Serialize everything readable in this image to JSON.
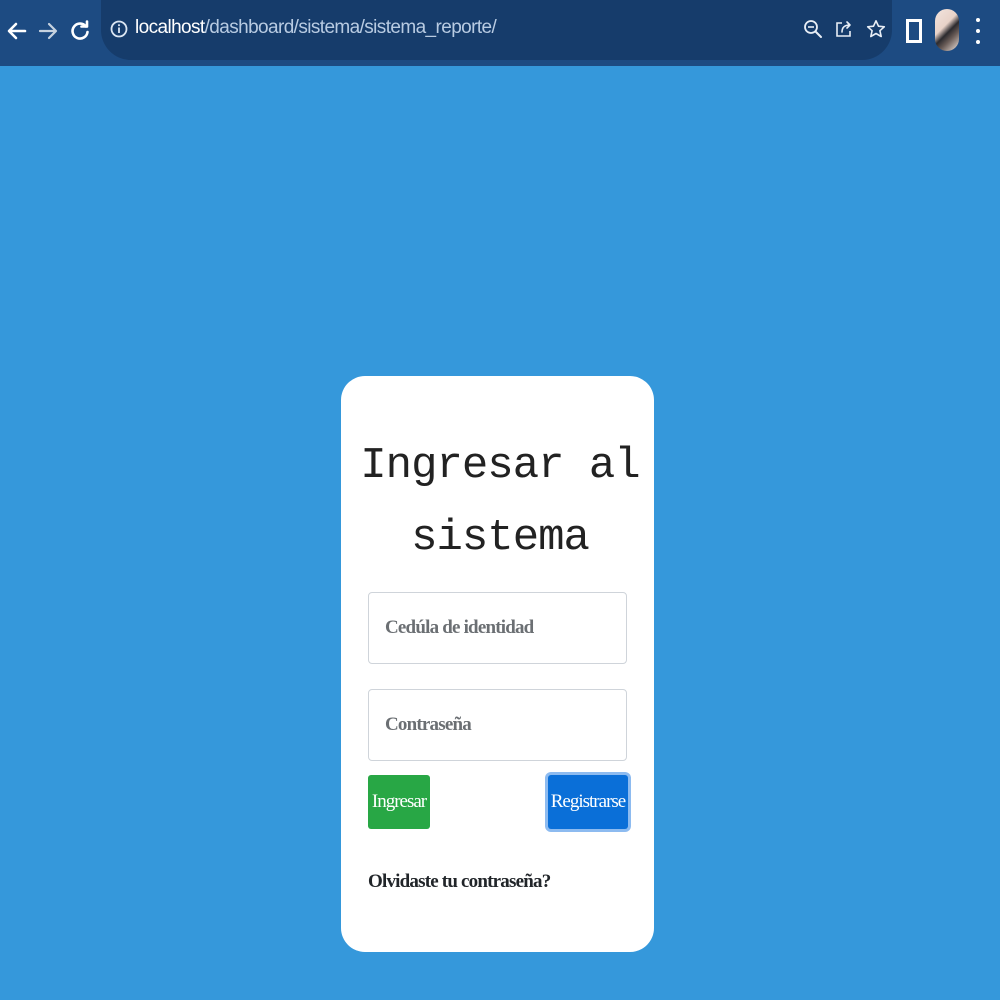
{
  "browser": {
    "url_host": "localhost",
    "url_path": "/dashboard/sistema/sistema_reporte/"
  },
  "login": {
    "title_line1": "Ingresar al",
    "title_line2": "sistema",
    "cedula_placeholder": "Cedúla de identidad",
    "password_placeholder": "Contraseña",
    "ingresar_label": "Ingresar",
    "registrarse_label": "Registrarse",
    "forgot_label": "Olvidaste tu contraseña?"
  },
  "colors": {
    "page_background": "#3598db",
    "browser_bar": "#1d4b82",
    "ingresar_button": "#28a745",
    "registrarse_button": "#0a6fd8"
  },
  "icons": {
    "back": "back-arrow-icon",
    "forward": "forward-arrow-icon",
    "reload": "reload-icon",
    "site_info": "info-icon",
    "zoom": "zoom-icon",
    "share": "share-icon",
    "bookmark": "star-icon",
    "side_panel": "side-panel-icon",
    "profile": "avatar",
    "menu": "kebab-menu-icon"
  }
}
